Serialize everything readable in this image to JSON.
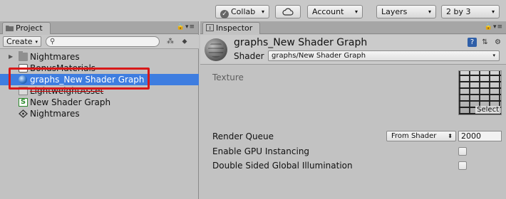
{
  "toolbar": {
    "collab_label": "Collab",
    "account_label": "Account",
    "layers_label": "Layers",
    "layout_label": "2 by 3",
    "dropdown_arrow": "▾"
  },
  "project": {
    "tab_label": "Project",
    "create_label": "Create",
    "search_value": "",
    "tree": [
      {
        "label": "Nightmares",
        "icon": "folder-icon",
        "expandable": true
      },
      {
        "label": "BonusMaterials",
        "icon": "unity-asset-icon"
      },
      {
        "label": "graphs_New Shader Graph",
        "icon": "material-sphere-icon",
        "selected": true
      },
      {
        "label": "LightweightAsset",
        "icon": "asset-icon"
      },
      {
        "label": "New Shader Graph",
        "icon": "shader-graph-icon"
      },
      {
        "label": "Nightmares",
        "icon": "unity-scene-icon"
      }
    ]
  },
  "inspector": {
    "tab_label": "Inspector",
    "title": "graphs_New Shader Graph",
    "shader_label": "Shader",
    "shader_value": "graphs/New Shader Graph",
    "texture_label": "Texture",
    "texture_select_label": "Select",
    "render_queue_label": "Render Queue",
    "render_queue_mode": "From Shader",
    "render_queue_value": "2000",
    "gpu_instancing_label": "Enable GPU Instancing",
    "gpu_instancing_checked": false,
    "double_sided_gi_label": "Double Sided Global Illumination",
    "double_sided_gi_checked": false
  },
  "colors": {
    "selection": "#3e7de0",
    "highlight_box": "#d81818"
  }
}
